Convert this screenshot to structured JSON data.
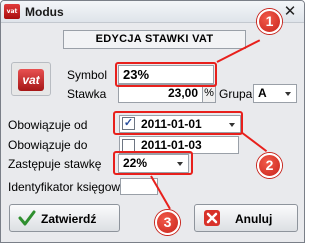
{
  "window": {
    "title": "Modus",
    "close_glyph": "✕"
  },
  "header": {
    "title": "EDYCJA STAWKI VAT"
  },
  "vat_icon": {
    "text": "vat",
    "name": "vat-icon"
  },
  "form": {
    "symbol_label": "Symbol",
    "symbol_value": "23%",
    "stawka_label": "Stawka",
    "stawka_value": "23,00",
    "stawka_unit": "%",
    "grupa_label": "Grupa",
    "grupa_value": "A",
    "obowiazuje_od_label": "Obowiązuje od",
    "obowiazuje_od_checked": true,
    "obowiazuje_od_value": "2011-01-01",
    "obowiazuje_do_label": "Obowiązuje do",
    "obowiazuje_do_checked": false,
    "obowiazuje_do_value": "2011-01-03",
    "zastepuje_label": "Zastępuje stawkę",
    "zastepuje_value": "22%",
    "identyfikator_label": "Identyfikator księgowy",
    "identyfikator_value": ""
  },
  "buttons": {
    "confirm_label": "Zatwierdź",
    "cancel_label": "Anuluj"
  },
  "callouts": [
    {
      "number": "1"
    },
    {
      "number": "2"
    },
    {
      "number": "3"
    }
  ],
  "colors": {
    "highlight": "#e8201c",
    "window_bg": "#e9eaed"
  }
}
